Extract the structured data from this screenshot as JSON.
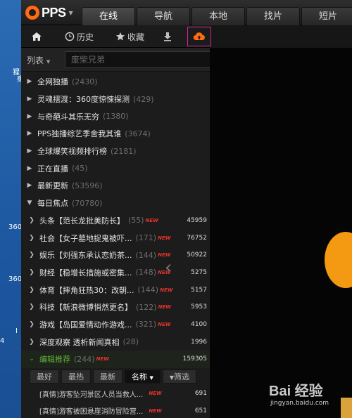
{
  "desktop": {
    "labels": [
      "猩",
      "豸",
      "360",
      "360",
      "I",
      "4"
    ]
  },
  "app": {
    "logo": "PPS",
    "tabs": [
      "在线",
      "导航",
      "本地",
      "找片",
      "短片"
    ],
    "toolbar": {
      "history": "历史",
      "favorites": "收藏",
      "upload_tooltip": "上传"
    },
    "search": {
      "dropdown": "列表",
      "placeholder": "废柴兄弟"
    },
    "categories": [
      {
        "title": "全网独播",
        "count": "(2430)"
      },
      {
        "title": "灵魂摆渡：360度惊悚探测",
        "count": "(429)"
      },
      {
        "title": "与奇葩斗其乐无穷",
        "count": "(1380)"
      },
      {
        "title": "PPS独播综艺季舍我其谁",
        "count": "(3674)"
      },
      {
        "title": "全球爆笑视频排行榜",
        "count": "(2181)"
      },
      {
        "title": "正在直播",
        "count": "(45)"
      },
      {
        "title": "最新更新",
        "count": "(53596)"
      },
      {
        "title": "每日焦点",
        "count": "(70780)"
      }
    ],
    "focus_items": [
      {
        "title": "头条【范长龙批美防长】",
        "count": "(55)",
        "new": "NEW",
        "num": "45959"
      },
      {
        "title": "社会【女子墓地捉鬼被吓...",
        "count": "(171)",
        "new": "NEW",
        "num": "76752"
      },
      {
        "title": "娱乐【刘强东承认恋奶茶...",
        "count": "(144)",
        "new": "NEW",
        "num": "50922"
      },
      {
        "title": "财经【稳增长措施或密集...",
        "count": "(148)",
        "new": "NEW",
        "num": "5275"
      },
      {
        "title": "体育【摔角狂热30：改朝...",
        "count": "(144)",
        "new": "NEW",
        "num": "5157"
      },
      {
        "title": "科技【新浪微博悄然更名】",
        "count": "(122)",
        "new": "NEW",
        "num": "5953"
      },
      {
        "title": "游戏【岛国爱情动作游戏...",
        "count": "(321)",
        "new": "NEW",
        "num": "4100"
      },
      {
        "title": "深度观察 透析新闻真相",
        "count": "(28)",
        "new": "",
        "num": "1996"
      }
    ],
    "editor": {
      "title": "编辑推荐",
      "count": "(244)",
      "new": "NEW",
      "num": "159305"
    },
    "filters": [
      "最好",
      "最热",
      "最新",
      "名称",
      "筛选"
    ],
    "videos": [
      {
        "title": "[真情]游客坠河景区人员当救人...",
        "new": "NEW",
        "num": "691"
      },
      {
        "title": "[真情]游客被困悬崖消防冒险营...",
        "new": "NEW",
        "num": "651"
      }
    ],
    "watermark": {
      "brand": "Bai 经验",
      "url": "jingyan.baidu.com"
    }
  },
  "colors": {
    "accent": "#ff6a13",
    "highlight_border": "#d1288f",
    "green": "#5fb23a",
    "new_badge": "#e8332a"
  }
}
